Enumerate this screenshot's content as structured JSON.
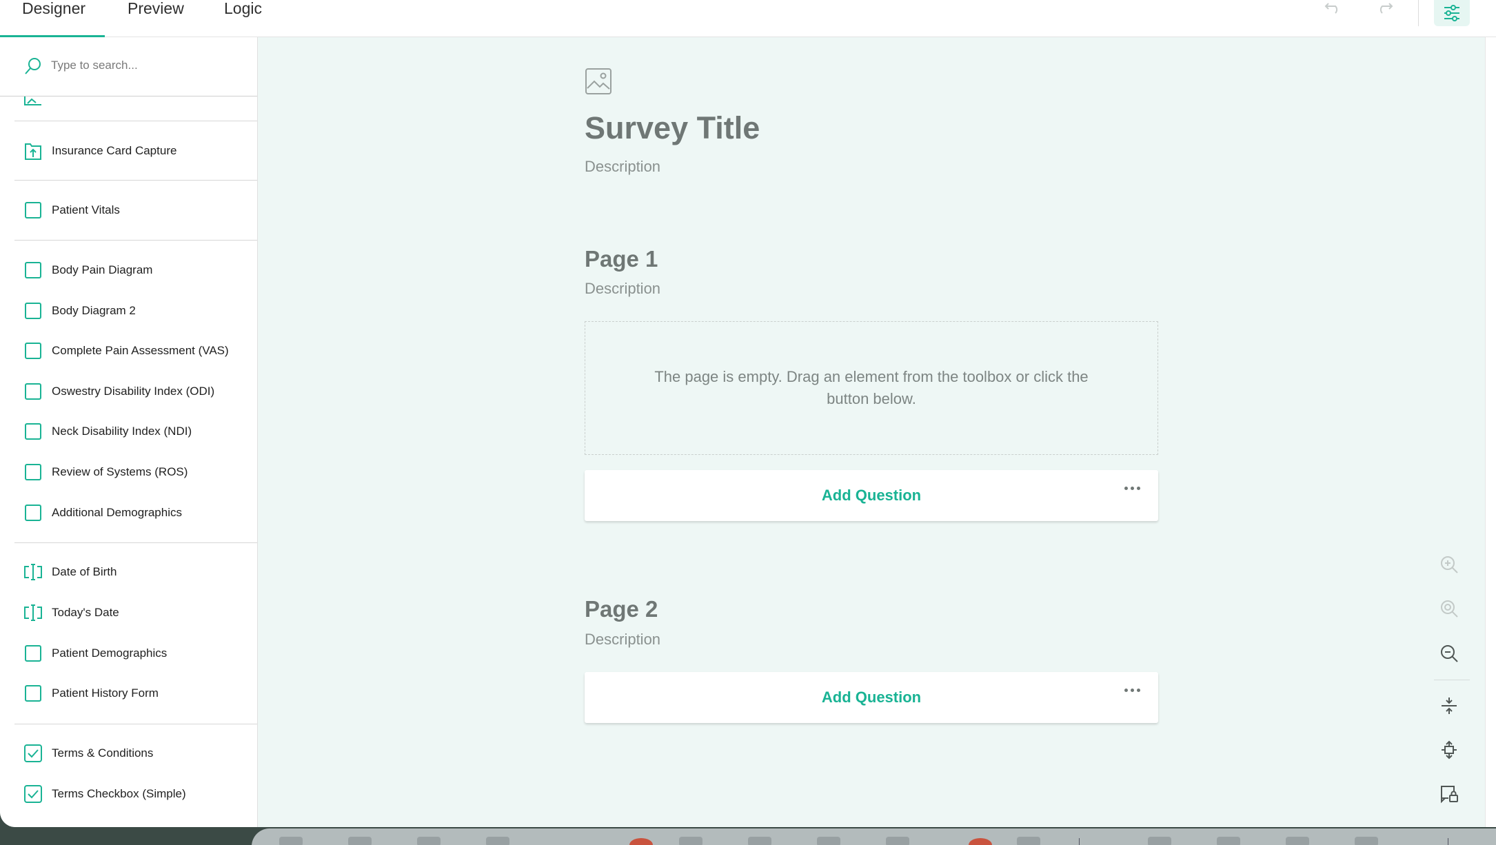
{
  "header": {
    "tabs": [
      {
        "label": "Designer",
        "active": true
      },
      {
        "label": "Preview",
        "active": false
      },
      {
        "label": "Logic",
        "active": false
      }
    ],
    "undo_icon": "undo-icon",
    "redo_icon": "redo-icon",
    "settings_icon": "settings-sliders-icon"
  },
  "toolbox": {
    "search_placeholder": "Type to search...",
    "items": [
      {
        "label": "Insurance Card Capture",
        "icon": "upload-file-icon"
      },
      {
        "label": "Patient Vitals",
        "icon": "checkbox-icon"
      },
      {
        "label": "Body Pain Diagram",
        "icon": "checkbox-icon"
      },
      {
        "label": "Body Diagram 2",
        "icon": "checkbox-icon"
      },
      {
        "label": "Complete Pain Assessment (VAS)",
        "icon": "checkbox-icon"
      },
      {
        "label": "Oswestry Disability Index (ODI)",
        "icon": "checkbox-icon"
      },
      {
        "label": "Neck Disability Index (NDI)",
        "icon": "checkbox-icon"
      },
      {
        "label": "Review of Systems (ROS)",
        "icon": "checkbox-icon"
      },
      {
        "label": "Additional Demographics",
        "icon": "checkbox-icon"
      },
      {
        "label": "Date of Birth",
        "icon": "text-input-icon"
      },
      {
        "label": "Today's Date",
        "icon": "text-input-icon"
      },
      {
        "label": "Patient Demographics",
        "icon": "checkbox-icon"
      },
      {
        "label": "Patient History Form",
        "icon": "checkbox-icon"
      },
      {
        "label": "Terms & Conditions",
        "icon": "checked-checkbox-icon"
      },
      {
        "label": "Terms Checkbox (Simple)",
        "icon": "checked-checkbox-icon"
      }
    ]
  },
  "survey": {
    "title": "Survey Title",
    "description": "Description",
    "pages": [
      {
        "title": "Page 1",
        "description": "Description",
        "empty_message": "The page is empty. Drag an element from the toolbox or click the button below.",
        "add_question_label": "Add Question"
      },
      {
        "title": "Page 2",
        "description": "Description",
        "add_question_label": "Add Question"
      }
    ]
  },
  "zoom_tools": [
    "zoom-in-icon",
    "zoom-to-fit-icon",
    "zoom-out-icon",
    "collapse-all-icon",
    "expand-all-icon",
    "lock-question-icon"
  ],
  "colors": {
    "accent": "#19b394",
    "canvas_bg": "#eef7f5",
    "title_text": "#6f7775"
  }
}
